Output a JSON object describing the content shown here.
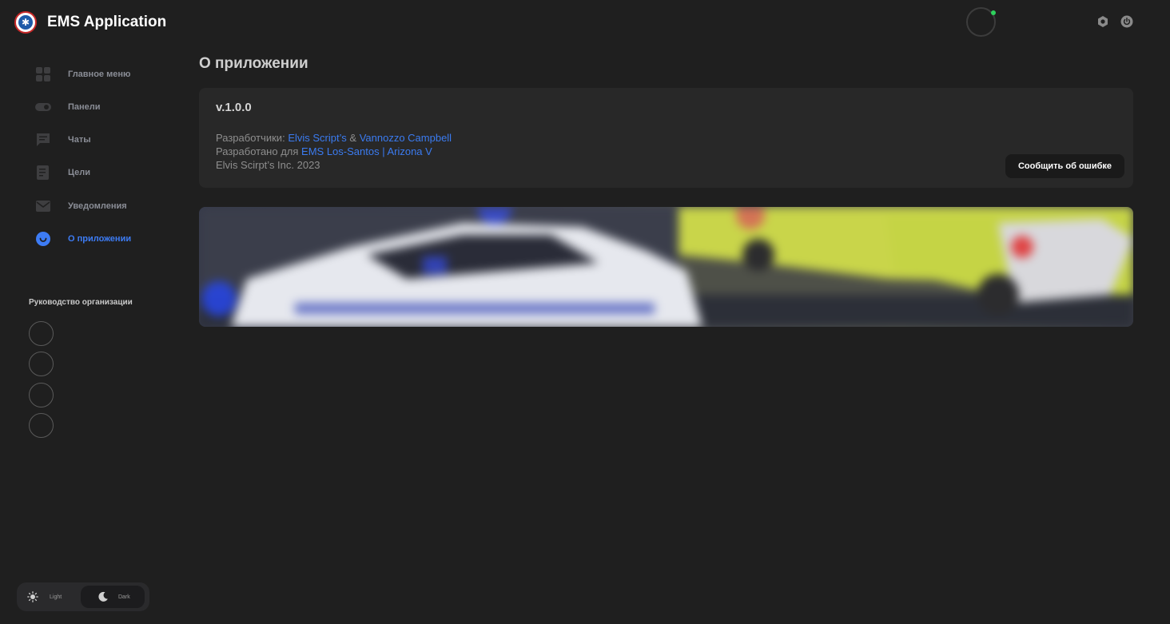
{
  "header": {
    "app_title": "EMS Application",
    "logo_icon": "ems-star-of-life-icon",
    "settings_icon": "gear-icon",
    "power_icon": "power-icon",
    "online_color": "#2ed15c"
  },
  "sidebar": {
    "items": [
      {
        "label": "Главное меню",
        "icon": "grid-icon",
        "active": false
      },
      {
        "label": "Панели",
        "icon": "toggle-icon",
        "active": false
      },
      {
        "label": "Чаты",
        "icon": "chat-icon",
        "active": false
      },
      {
        "label": "Цели",
        "icon": "checklist-icon",
        "active": false
      },
      {
        "label": "Уведомления",
        "icon": "mail-icon",
        "active": false
      },
      {
        "label": "О приложении",
        "icon": "info-circle-icon",
        "active": true
      }
    ],
    "leadership_title": "Руководство организации",
    "accent_color": "#3d7cf5"
  },
  "theme_switch": {
    "light_label": "Light",
    "dark_label": "Dark",
    "selected": "Dark"
  },
  "main": {
    "page_title": "О приложении",
    "card": {
      "version": "v.1.0.0",
      "developers_prefix": "Разработчики:",
      "developer_1": "Elvis Script’s",
      "developers_sep": "&",
      "developer_2": "Vannozzo Campbell",
      "developed_for_prefix": "Разработано для",
      "developed_for": "EMS Los-Santos | Arizona V",
      "copyright": "Elvis Scirpt’s Inc. 2023",
      "report_button": "Сообщить об ошибке"
    }
  }
}
